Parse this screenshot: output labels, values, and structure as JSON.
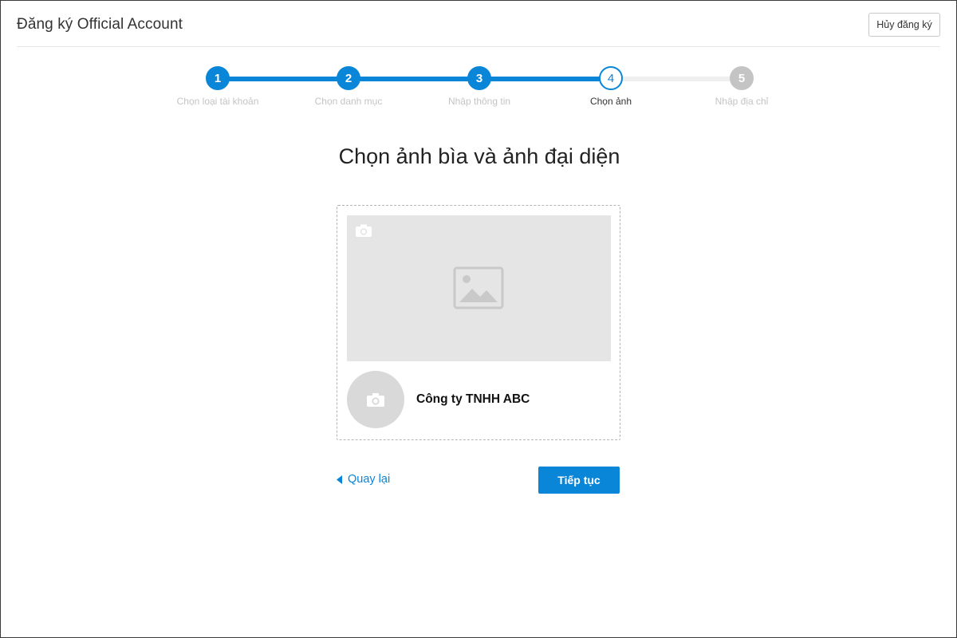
{
  "header": {
    "title": "Đăng ký Official Account",
    "cancel_label": "Hủy đăng ký"
  },
  "stepper": {
    "current_step": 4,
    "steps": [
      {
        "number": "1",
        "label": "Chọn loại tài khoản",
        "state": "done"
      },
      {
        "number": "2",
        "label": "Chọn danh mục",
        "state": "done"
      },
      {
        "number": "3",
        "label": "Nhập thông tin",
        "state": "done"
      },
      {
        "number": "4",
        "label": "Chọn ảnh",
        "state": "current"
      },
      {
        "number": "5",
        "label": "Nhập địa chỉ",
        "state": "todo"
      }
    ]
  },
  "main": {
    "title": "Chọn ảnh bìa và ảnh đại diện",
    "card": {
      "cover_icon": "camera-icon",
      "cover_placeholder_icon": "image-placeholder-icon",
      "avatar_icon": "camera-icon",
      "company_name": "Công ty TNHH ABC"
    }
  },
  "actions": {
    "back_label": "Quay lại",
    "next_label": "Tiếp tục"
  },
  "colors": {
    "accent": "#0a86d9",
    "inactive": "#c4c4c4",
    "placeholder_bg": "#e5e5e5"
  }
}
